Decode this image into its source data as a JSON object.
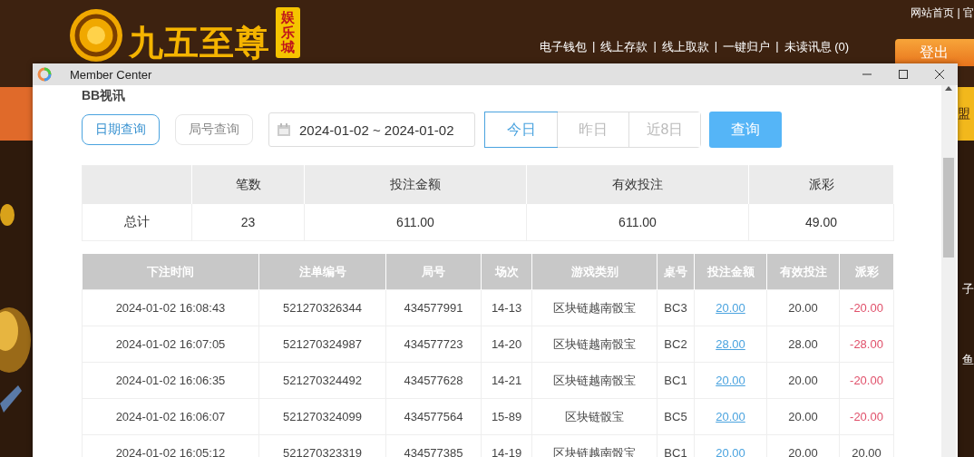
{
  "site": {
    "brand": "九五至尊",
    "brand_badge": "娱乐城",
    "top_links": "网站首页 | 官",
    "nav_separator": "|",
    "nav": [
      "电子钱包",
      "线上存款",
      "线上取款",
      "一键归户",
      "未读讯息 (0)"
    ],
    "logout": "登出",
    "side_labels": [
      "盟",
      "子",
      "鱼"
    ]
  },
  "window": {
    "title": "Member Center",
    "heading": "BB视讯",
    "query_modes": [
      {
        "label": "日期查询",
        "selected": true
      },
      {
        "label": "局号查询",
        "selected": false
      }
    ],
    "date_range": {
      "value": "2024-01-02 ~ 2024-01-02"
    },
    "quick_ranges": [
      {
        "label": "今日",
        "selected": true
      },
      {
        "label": "昨日",
        "selected": false
      },
      {
        "label": "近8日",
        "selected": false
      }
    ],
    "query_button": "查询",
    "summary": {
      "columns": [
        "",
        "笔数",
        "投注金额",
        "有效投注",
        "派彩"
      ],
      "rows": [
        [
          "总计",
          "23",
          "611.00",
          "611.00",
          "49.00"
        ]
      ]
    },
    "bets": {
      "columns": [
        "下注时间",
        "注单编号",
        "局号",
        "场次",
        "游戏类别",
        "桌号",
        "投注金额",
        "有效投注",
        "派彩"
      ],
      "rows": [
        {
          "time": "2024-01-02 16:08:43",
          "order_no": "521270326344",
          "round_no": "434577991",
          "session": "14-13",
          "game": "区块链越南骰宝",
          "table": "BC3",
          "stake": "20.00",
          "valid": "20.00",
          "payout": "-20.00",
          "loss": true
        },
        {
          "time": "2024-01-02 16:07:05",
          "order_no": "521270324987",
          "round_no": "434577723",
          "session": "14-20",
          "game": "区块链越南骰宝",
          "table": "BC2",
          "stake": "28.00",
          "valid": "28.00",
          "payout": "-28.00",
          "loss": true
        },
        {
          "time": "2024-01-02 16:06:35",
          "order_no": "521270324492",
          "round_no": "434577628",
          "session": "14-21",
          "game": "区块链越南骰宝",
          "table": "BC1",
          "stake": "20.00",
          "valid": "20.00",
          "payout": "-20.00",
          "loss": true
        },
        {
          "time": "2024-01-02 16:06:07",
          "order_no": "521270324099",
          "round_no": "434577564",
          "session": "15-89",
          "game": "区块链骰宝",
          "table": "BC5",
          "stake": "20.00",
          "valid": "20.00",
          "payout": "-20.00",
          "loss": true
        },
        {
          "time": "2024-01-02 16:05:12",
          "order_no": "521270323319",
          "round_no": "434577385",
          "session": "14-19",
          "game": "区块链越南骰宝",
          "table": "BC1",
          "stake": "20.00",
          "valid": "20.00",
          "payout": "20.00",
          "loss": false
        }
      ]
    }
  }
}
